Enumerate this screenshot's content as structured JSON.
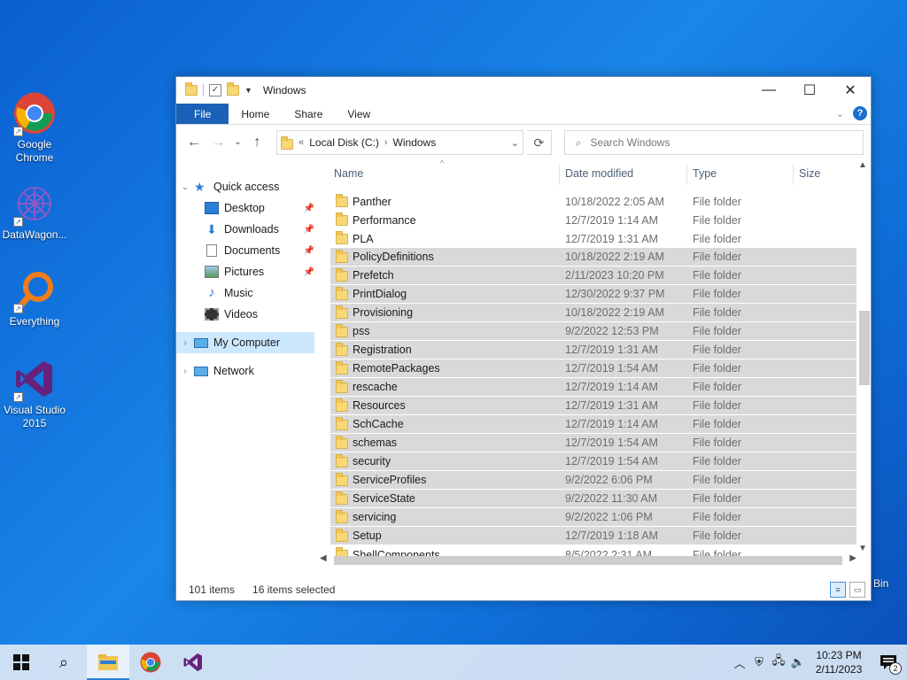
{
  "desktop": {
    "icons": [
      {
        "label": "Google\nChrome",
        "line1": "Google",
        "line2": "Chrome",
        "icon": "chrome-icon"
      },
      {
        "label": "DataWagon...",
        "line1": "DataWagon...",
        "line2": "",
        "icon": "datawagon-icon"
      },
      {
        "label": "Everything",
        "line1": "Everything",
        "line2": "",
        "icon": "everything-icon"
      },
      {
        "label": "Visual Studio 2015",
        "line1": "Visual Studio",
        "line2": "2015",
        "icon": "visual-studio-icon"
      }
    ],
    "recycle_bin_partial": "Bin"
  },
  "window": {
    "title": "Windows",
    "ribbon_tabs": [
      "File",
      "Home",
      "Share",
      "View"
    ],
    "address": {
      "overflow": "«",
      "crumbs": [
        "Local Disk (C:)",
        "Windows"
      ]
    },
    "search": {
      "placeholder": "Search Windows"
    },
    "nav": {
      "quick_access": "Quick access",
      "items": [
        {
          "label": "Desktop",
          "pinned": true
        },
        {
          "label": "Downloads",
          "pinned": true
        },
        {
          "label": "Documents",
          "pinned": true
        },
        {
          "label": "Pictures",
          "pinned": true
        },
        {
          "label": "Music",
          "pinned": false
        },
        {
          "label": "Videos",
          "pinned": false
        }
      ],
      "my_computer": "My Computer",
      "network": "Network"
    },
    "columns": {
      "name": "Name",
      "date": "Date modified",
      "type": "Type",
      "size": "Size"
    },
    "files": [
      {
        "name": "Panther",
        "date": "10/18/2022 2:05 AM",
        "type": "File folder",
        "selected": false
      },
      {
        "name": "Performance",
        "date": "12/7/2019 1:14 AM",
        "type": "File folder",
        "selected": false
      },
      {
        "name": "PLA",
        "date": "12/7/2019 1:31 AM",
        "type": "File folder",
        "selected": false
      },
      {
        "name": "PolicyDefinitions",
        "date": "10/18/2022 2:19 AM",
        "type": "File folder",
        "selected": true
      },
      {
        "name": "Prefetch",
        "date": "2/11/2023 10:20 PM",
        "type": "File folder",
        "selected": true
      },
      {
        "name": "PrintDialog",
        "date": "12/30/2022 9:37 PM",
        "type": "File folder",
        "selected": true
      },
      {
        "name": "Provisioning",
        "date": "10/18/2022 2:19 AM",
        "type": "File folder",
        "selected": true
      },
      {
        "name": "pss",
        "date": "9/2/2022 12:53 PM",
        "type": "File folder",
        "selected": true
      },
      {
        "name": "Registration",
        "date": "12/7/2019 1:31 AM",
        "type": "File folder",
        "selected": true
      },
      {
        "name": "RemotePackages",
        "date": "12/7/2019 1:54 AM",
        "type": "File folder",
        "selected": true
      },
      {
        "name": "rescache",
        "date": "12/7/2019 1:14 AM",
        "type": "File folder",
        "selected": true
      },
      {
        "name": "Resources",
        "date": "12/7/2019 1:31 AM",
        "type": "File folder",
        "selected": true
      },
      {
        "name": "SchCache",
        "date": "12/7/2019 1:14 AM",
        "type": "File folder",
        "selected": true
      },
      {
        "name": "schemas",
        "date": "12/7/2019 1:54 AM",
        "type": "File folder",
        "selected": true
      },
      {
        "name": "security",
        "date": "12/7/2019 1:54 AM",
        "type": "File folder",
        "selected": true
      },
      {
        "name": "ServiceProfiles",
        "date": "9/2/2022 6:06 PM",
        "type": "File folder",
        "selected": true
      },
      {
        "name": "ServiceState",
        "date": "9/2/2022 11:30 AM",
        "type": "File folder",
        "selected": true
      },
      {
        "name": "servicing",
        "date": "9/2/2022 1:06 PM",
        "type": "File folder",
        "selected": true
      },
      {
        "name": "Setup",
        "date": "12/7/2019 1:18 AM",
        "type": "File folder",
        "selected": true
      },
      {
        "name": "ShellComponents",
        "date": "8/5/2022 2:31 AM",
        "type": "File folder",
        "selected": false
      }
    ],
    "status": {
      "items": "101 items",
      "selected": "16 items selected"
    }
  },
  "taskbar": {
    "clock_time": "10:23 PM",
    "clock_date": "2/11/2023",
    "notification_count": "2"
  }
}
